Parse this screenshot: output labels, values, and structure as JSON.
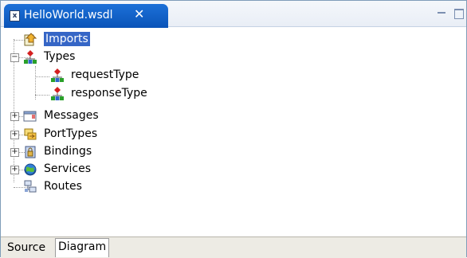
{
  "editor": {
    "tab_title": "HelloWorld.wsdl",
    "close_symbol": "✕",
    "file_icon_text": "x"
  },
  "tree": {
    "nodes": [
      {
        "label": "Imports",
        "icon": "import-icon",
        "selected": true
      },
      {
        "label": "Types",
        "icon": "types-icon",
        "expanded": true
      },
      {
        "label": "requestType",
        "icon": "type-icon"
      },
      {
        "label": "responseType",
        "icon": "type-icon"
      },
      {
        "label": "Messages",
        "icon": "message-icon",
        "expanded": false
      },
      {
        "label": "PortTypes",
        "icon": "porttype-icon",
        "expanded": false
      },
      {
        "label": "Bindings",
        "icon": "binding-icon",
        "expanded": false
      },
      {
        "label": "Services",
        "icon": "service-icon",
        "expanded": false
      },
      {
        "label": "Routes",
        "icon": "routes-icon"
      }
    ],
    "expanders": {
      "collapsed": "+",
      "expanded": "−"
    }
  },
  "bottom_tabs": [
    {
      "label": "Source",
      "active": false
    },
    {
      "label": "Diagram",
      "active": true
    }
  ],
  "colors": {
    "selection": "#3666c6",
    "tab_active": "#0a54b8"
  }
}
